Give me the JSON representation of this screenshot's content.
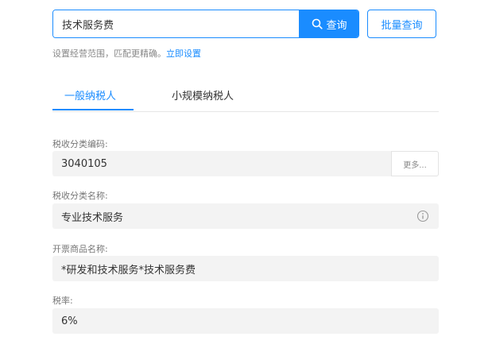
{
  "search": {
    "value": "技术服务费",
    "query_label": "查询",
    "batch_label": "批量查询"
  },
  "hint": {
    "text": "设置经营范围，匹配更精确。",
    "link": "立即设置"
  },
  "tabs": [
    {
      "label": "一般纳税人",
      "active": true
    },
    {
      "label": "小规模纳税人",
      "active": false
    }
  ],
  "fields": {
    "tax_code": {
      "label": "税收分类编码:",
      "value": "3040105",
      "more_label": "更多..."
    },
    "tax_name": {
      "label": "税收分类名称:",
      "value": "专业技术服务"
    },
    "invoice_name": {
      "label": "开票商品名称:",
      "value": "*研发和技术服务*技术服务费"
    },
    "tax_rate": {
      "label": "税率:",
      "value": "6%"
    }
  },
  "colors": {
    "accent": "#1a8cff",
    "field_bg": "#f3f3f3"
  },
  "icons": {
    "query": "search-icon",
    "info": "info-icon"
  }
}
